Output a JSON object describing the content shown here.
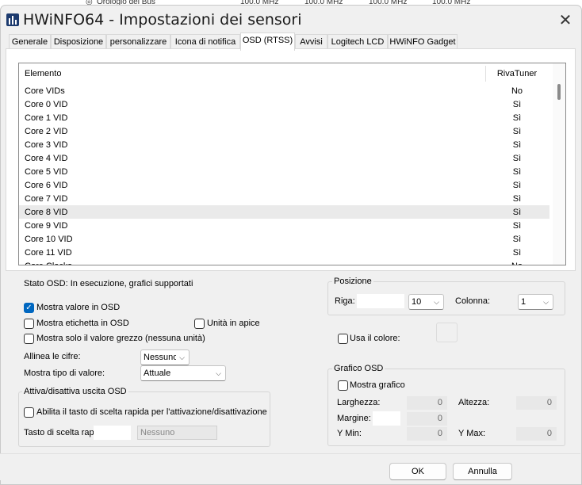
{
  "background_window": {
    "row_label": "Orologio del Bus",
    "values": [
      "100.0 MHz",
      "100.0 MHz",
      "100.0 MHz",
      "100.0 MHz"
    ]
  },
  "window": {
    "title": "HWiNFO64 - Impostazioni dei sensori",
    "close_glyph": "✕"
  },
  "tabs": [
    {
      "label": "Generale",
      "active": false
    },
    {
      "label": "Disposizione",
      "active": false
    },
    {
      "label": "personalizzare",
      "active": false
    },
    {
      "label": "Icona di notifica",
      "active": false
    },
    {
      "label": "OSD (RTSS)",
      "active": true
    },
    {
      "label": "Avvisi",
      "active": false
    },
    {
      "label": "Logitech LCD",
      "active": false
    },
    {
      "label": "HWiNFO Gadget",
      "active": false
    }
  ],
  "list": {
    "columns": {
      "element": "Elemento",
      "rivatuner": "RivaTuner"
    },
    "rows": [
      {
        "name": "Core VIDs",
        "value": "No"
      },
      {
        "name": "Core 0 VID",
        "value": "Sì"
      },
      {
        "name": "Core 1 VID",
        "value": "Sì"
      },
      {
        "name": "Core 2 VID",
        "value": "Sì"
      },
      {
        "name": "Core 3 VID",
        "value": "Sì"
      },
      {
        "name": "Core 4 VID",
        "value": "Sì"
      },
      {
        "name": "Core 5 VID",
        "value": "Sì"
      },
      {
        "name": "Core 6 VID",
        "value": "Sì"
      },
      {
        "name": "Core 7 VID",
        "value": "Sì"
      },
      {
        "name": "Core 8 VID",
        "value": "Sì",
        "selected": true
      },
      {
        "name": "Core 9 VID",
        "value": "Sì"
      },
      {
        "name": "Core 10 VID",
        "value": "Sì"
      },
      {
        "name": "Core 11 VID",
        "value": "Sì"
      },
      {
        "name": "Core Clocks",
        "value": "No"
      }
    ]
  },
  "osd": {
    "status": "Stato OSD: In esecuzione, grafici supportati",
    "show_value": {
      "label": "Mostra valore in OSD",
      "checked": true
    },
    "show_label": {
      "label": "Mostra etichetta in OSD",
      "checked": false
    },
    "unit_superscript": {
      "label": "Unità in apice",
      "checked": false
    },
    "raw_only": {
      "label": "Mostra solo il valore grezzo (nessuna unità)",
      "checked": false
    },
    "align_digits": {
      "label": "Allinea le cifre:",
      "value": "Nessuno"
    },
    "value_type": {
      "label": "Mostra tipo di valore:",
      "value": "Attuale"
    },
    "toggle_group": {
      "title": "Attiva/disattiva uscita OSD",
      "hotkey_enable": {
        "label": "Abilita il tasto di scelta rapida per l'attivazione/disattivazione",
        "checked": false
      },
      "hotkey_label": "Tasto di scelta rapida",
      "hotkey_value": "Nessuno"
    }
  },
  "position": {
    "title": "Posizione",
    "row_label": "Riga:",
    "row_value": "10",
    "col_label": "Colonna:",
    "col_value": "1"
  },
  "use_color": {
    "label": "Usa il colore:",
    "checked": false
  },
  "graph": {
    "title": "Grafico OSD",
    "show_graph": {
      "label": "Mostra grafico",
      "checked": false
    },
    "width_label": "Larghezza:",
    "width_value": "0",
    "height_label": "Altezza:",
    "height_value": "0",
    "margin_label": "Margine:",
    "margin_value": "0",
    "ymin_label": "Y Min:",
    "ymin_value": "0",
    "ymax_label": "Y Max:",
    "ymax_value": "0"
  },
  "buttons": {
    "ok": "OK",
    "cancel": "Annulla"
  },
  "icons": {
    "checkmark": "✓",
    "chevron": "⌵"
  }
}
